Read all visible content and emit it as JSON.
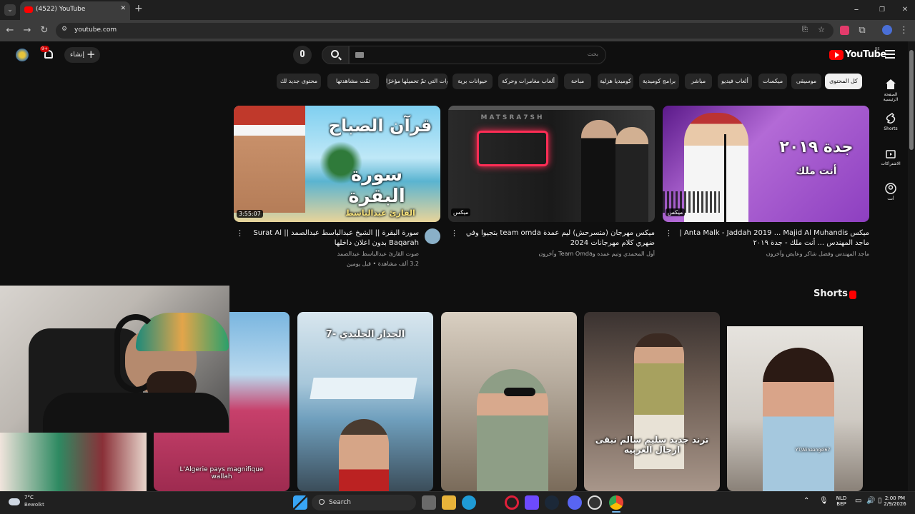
{
  "browser": {
    "tab_title": "(4522) YouTube",
    "url": "youtube.com",
    "tab_close": "✕",
    "new_tab": "+"
  },
  "header": {
    "logo_text": "YouTube",
    "region": "BE",
    "search_placeholder": "بحث",
    "create_label": "إنشاء",
    "notif_badge": "9+"
  },
  "chips": [
    {
      "label": "كل المحتوى",
      "active": true
    },
    {
      "label": "موسيقى"
    },
    {
      "label": "ميكسات"
    },
    {
      "label": "ألعاب فيديو"
    },
    {
      "label": "مباشر"
    },
    {
      "label": "برامج كوميدية"
    },
    {
      "label": "كوميديا هزلية"
    },
    {
      "label": "مباحة"
    },
    {
      "label": "ألعاب مغامرات وحركة"
    },
    {
      "label": "حيوانات برية"
    },
    {
      "label": "القنوات التي تمّ تحميلها مؤخرًا"
    },
    {
      "label": "تمّت مشاهدتها"
    },
    {
      "label": "محتوى جديد لك"
    }
  ],
  "sidenav": [
    {
      "label": "الصفحة الرئيسية",
      "icon": "home-icon"
    },
    {
      "label": "Shorts",
      "icon": "shorts-icon"
    },
    {
      "label": "الاشتراكات",
      "icon": "subscriptions-icon"
    },
    {
      "label": "أنت",
      "icon": "account-icon"
    }
  ],
  "videos": [
    {
      "title": "سورة البقرة || الشيخ عبدالباسط عبدالصمد || Surat Al Baqarah بدون اعلان داخلها",
      "channel": "صوت القارئ عبدالباسط عبدالصمد",
      "stats": "3.2 ألف مشاهدة • قبل يومين",
      "duration": "3:55:07",
      "thumb_text_1": "قرآن الصباح",
      "thumb_text_2": "سورة البقرة",
      "thumb_text_3": "القارئ عبدالباسط"
    },
    {
      "title": "ميكس مهرجان (متسرحش) ليم عمدة team omda بتجيوا وفي ضهري كلام مهرجانات 2024",
      "channel": "أول المحمدي وتيم عمده وTeam Omda وآخرون",
      "badge": "ميكس",
      "thumb_text_1": "MATSRA7SH"
    },
    {
      "title": "ميكس Anta Malk - Jaddah 2019 ... Majid Al Muhandis | ماجد المهندس ... أنت ملك - جدة ٢٠١٩",
      "channel": "ماجد المهندس وفضل شاكر وعايض وآخرون",
      "badge": "ميكس",
      "thumb_text_1": "جدة ٢٠١٩",
      "thumb_text_2": "أنت ملك"
    }
  ],
  "shorts_title": "Shorts",
  "shorts": [
    {
      "caption": "L'Algerie pays magnifique wallah"
    },
    {
      "caption": "7- الجدار الجليدي"
    },
    {
      "caption": ""
    },
    {
      "caption": "ترند جديد سليم سالم نبقى ارجال الغربيه"
    },
    {
      "caption": "YT/Alinaangel67"
    }
  ],
  "taskbar": {
    "weather_temp": "7°C",
    "weather_desc": "Bewolkt",
    "search_label": "Search",
    "lang_top": "NLD",
    "lang_bottom": "BEP",
    "time": "2:00 PM",
    "date": "2/9/2026"
  },
  "colors": {
    "background": "#0f0f0f",
    "youtube_red": "#ff0000",
    "chip_bg": "#272727",
    "chip_active_bg": "#f1f1f1"
  }
}
